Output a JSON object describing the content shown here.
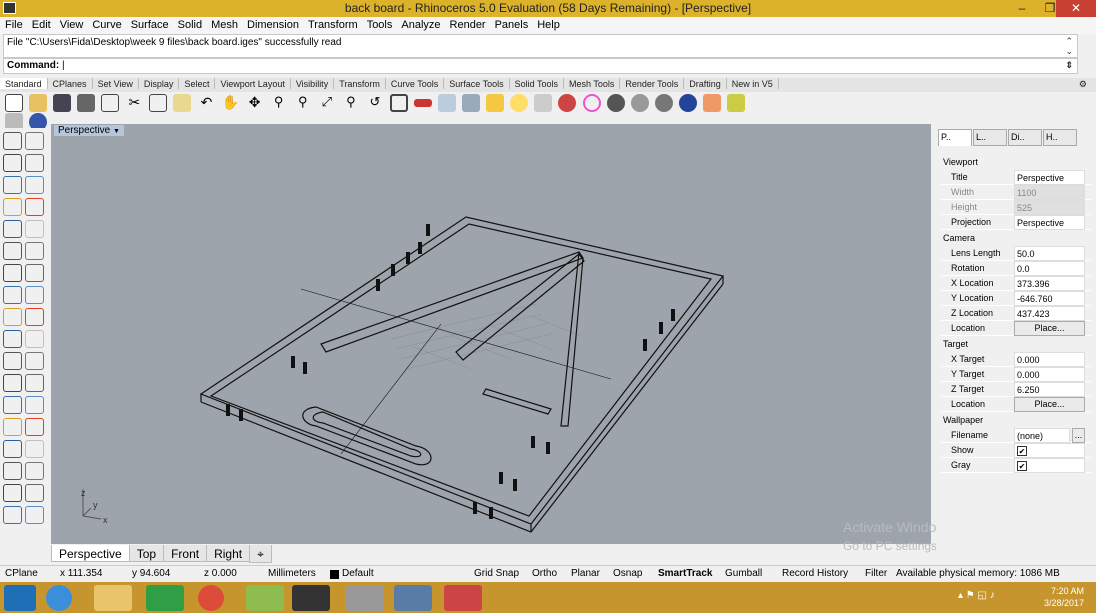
{
  "window": {
    "title": "back board - Rhinoceros 5.0 Evaluation (58 Days Remaining) - [Perspective]",
    "minimize": "–",
    "restore": "❐",
    "close": "✕"
  },
  "menu": [
    "File",
    "Edit",
    "View",
    "Curve",
    "Surface",
    "Solid",
    "Mesh",
    "Dimension",
    "Transform",
    "Tools",
    "Analyze",
    "Render",
    "Panels",
    "Help"
  ],
  "command": {
    "history": "File \"C:\\Users\\Fida\\Desktop\\week 9 files\\back board.iges\" successfully read",
    "prompt": "Command:",
    "value": ""
  },
  "toolbar_tabs": [
    "Standard",
    "CPlanes",
    "Set View",
    "Display",
    "Select",
    "Viewport Layout",
    "Visibility",
    "Transform",
    "Curve Tools",
    "Surface Tools",
    "Solid Tools",
    "Mesh Tools",
    "Render Tools",
    "Drafting",
    "New in V5"
  ],
  "viewport": {
    "label": "Perspective",
    "dropdown": "▼"
  },
  "viewport_tabs": [
    "Perspective",
    "Top",
    "Front",
    "Right",
    "⌖"
  ],
  "watermark": {
    "line1": "Activate Windows",
    "line2": "Go to PC settings to activate Windows."
  },
  "panel": {
    "tabs": [
      "P..",
      "L..",
      "Di..",
      "H.."
    ],
    "viewport_section": "Viewport",
    "title_k": "Title",
    "title_v": "Perspective",
    "width_k": "Width",
    "width_v": "1100",
    "height_k": "Height",
    "height_v": "525",
    "projection_k": "Projection",
    "projection_v": "Perspective",
    "camera_section": "Camera",
    "lens_k": "Lens Length",
    "lens_v": "50.0",
    "rot_k": "Rotation",
    "rot_v": "0.0",
    "xloc_k": "X Location",
    "xloc_v": "373.396",
    "yloc_k": "Y Location",
    "yloc_v": "-646.760",
    "zloc_k": "Z Location",
    "zloc_v": "437.423",
    "loc_k": "Location",
    "place": "Place...",
    "target_section": "Target",
    "xt_k": "X Target",
    "xt_v": "0.000",
    "yt_k": "Y Target",
    "yt_v": "0.000",
    "zt_k": "Z Target",
    "zt_v": "6.250",
    "wallpaper_section": "Wallpaper",
    "file_k": "Filename",
    "file_v": "(none)",
    "dots": "...",
    "show_k": "Show",
    "gray_k": "Gray",
    "check": "✔"
  },
  "status": {
    "cplane": "CPlane",
    "x": "x 111.354",
    "y": "y 94.604",
    "z": "z 0.000",
    "units": "Millimeters",
    "layer": "Default",
    "gridsnap": "Grid Snap",
    "ortho": "Ortho",
    "planar": "Planar",
    "osnap": "Osnap",
    "smarttrack": "SmartTrack",
    "gumball": "Gumball",
    "history": "Record History",
    "filter": "Filter",
    "memory": "Available physical memory: 1086 MB"
  },
  "clock": {
    "time": "7:20 AM",
    "date": "3/28/2017"
  },
  "colors": {
    "titlebar": "#dcb22b",
    "taskbar": "#c6952e",
    "viewport": "#9ea4ab"
  }
}
